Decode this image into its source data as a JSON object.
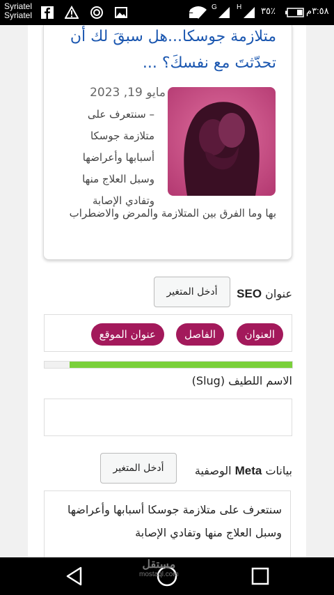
{
  "status_bar": {
    "carrier_1": "Syriatel",
    "carrier_2": "Syriatel",
    "network_g": "G",
    "network_h": "H",
    "battery": "٣٥٪",
    "time": "٣:٥٨م"
  },
  "post": {
    "title": "متلازمة جوسكا...هل سبقَ لك أن تحدّثتَ مع نفسكَ؟ ...",
    "date": "مايو 19, 2023",
    "excerpt_part1": "– سنتعرف على متلازمة جوسكا أسبابها وأعراضها وسبل العلاج منها وتفادي الإصابة",
    "excerpt_part2": "بها وما الفرق بين المتلازمة والمرض والاضطراب",
    "thumbnail_icon": "silhouette-heads-image"
  },
  "seo_title": {
    "label_prefix": "عنوان",
    "label_bold": "SEO",
    "insert_variable_button": "أدخل المتغير",
    "tags": [
      "العنوان",
      "الفاصل",
      "عنوان الموقع"
    ],
    "progress": 0.9,
    "progress_color": "#7ad03a"
  },
  "slug": {
    "label": "الاسم اللطيف (Slug)",
    "value": ""
  },
  "meta_description": {
    "label_prefix": "بيانات",
    "label_bold": "Meta",
    "label_suffix": "الوصفية",
    "insert_variable_button": "أدخل المتغير",
    "value": "سنتعرف على متلازمة جوسكا أسبابها وأعراضها وسبل العلاج منها وتفادي الإصابة"
  },
  "watermark": {
    "arabic": "مستقل",
    "latin": "mostaql.com"
  },
  "colors": {
    "link_blue": "#1b57b0",
    "tag_magenta": "#a3195b"
  },
  "nav_icons": [
    "back-icon",
    "home-icon",
    "recents-icon"
  ]
}
